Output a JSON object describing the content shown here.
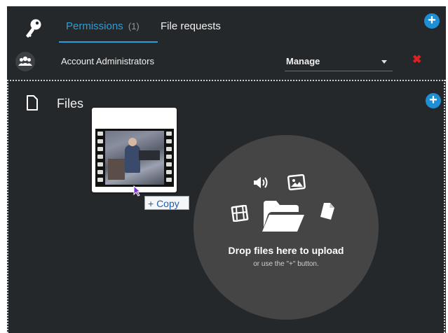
{
  "header": {
    "tabs": [
      {
        "label": "Permissions",
        "count": "(1)"
      },
      {
        "label": "File requests"
      }
    ]
  },
  "permissions": {
    "group_name": "Account Administrators",
    "role_value": "Manage"
  },
  "files": {
    "title": "Files"
  },
  "dropzone": {
    "main_text": "Drop files here to upload",
    "sub_text": "or use the \"+\" button."
  },
  "drag": {
    "tooltip": "+ Copy"
  },
  "colors": {
    "panel_bg": "#25282b",
    "accent": "#2a9fd8",
    "plus_button": "#1e8fd5",
    "remove": "#e02020",
    "dropzone": "#454545"
  },
  "icons": [
    "key-icon",
    "group-icon",
    "plus-icon",
    "remove-icon",
    "file-icon",
    "volume-icon",
    "image-icon",
    "film-icon",
    "folder-open-icon",
    "document-icon",
    "video-thumbnail",
    "drag-cursor-icon"
  ]
}
